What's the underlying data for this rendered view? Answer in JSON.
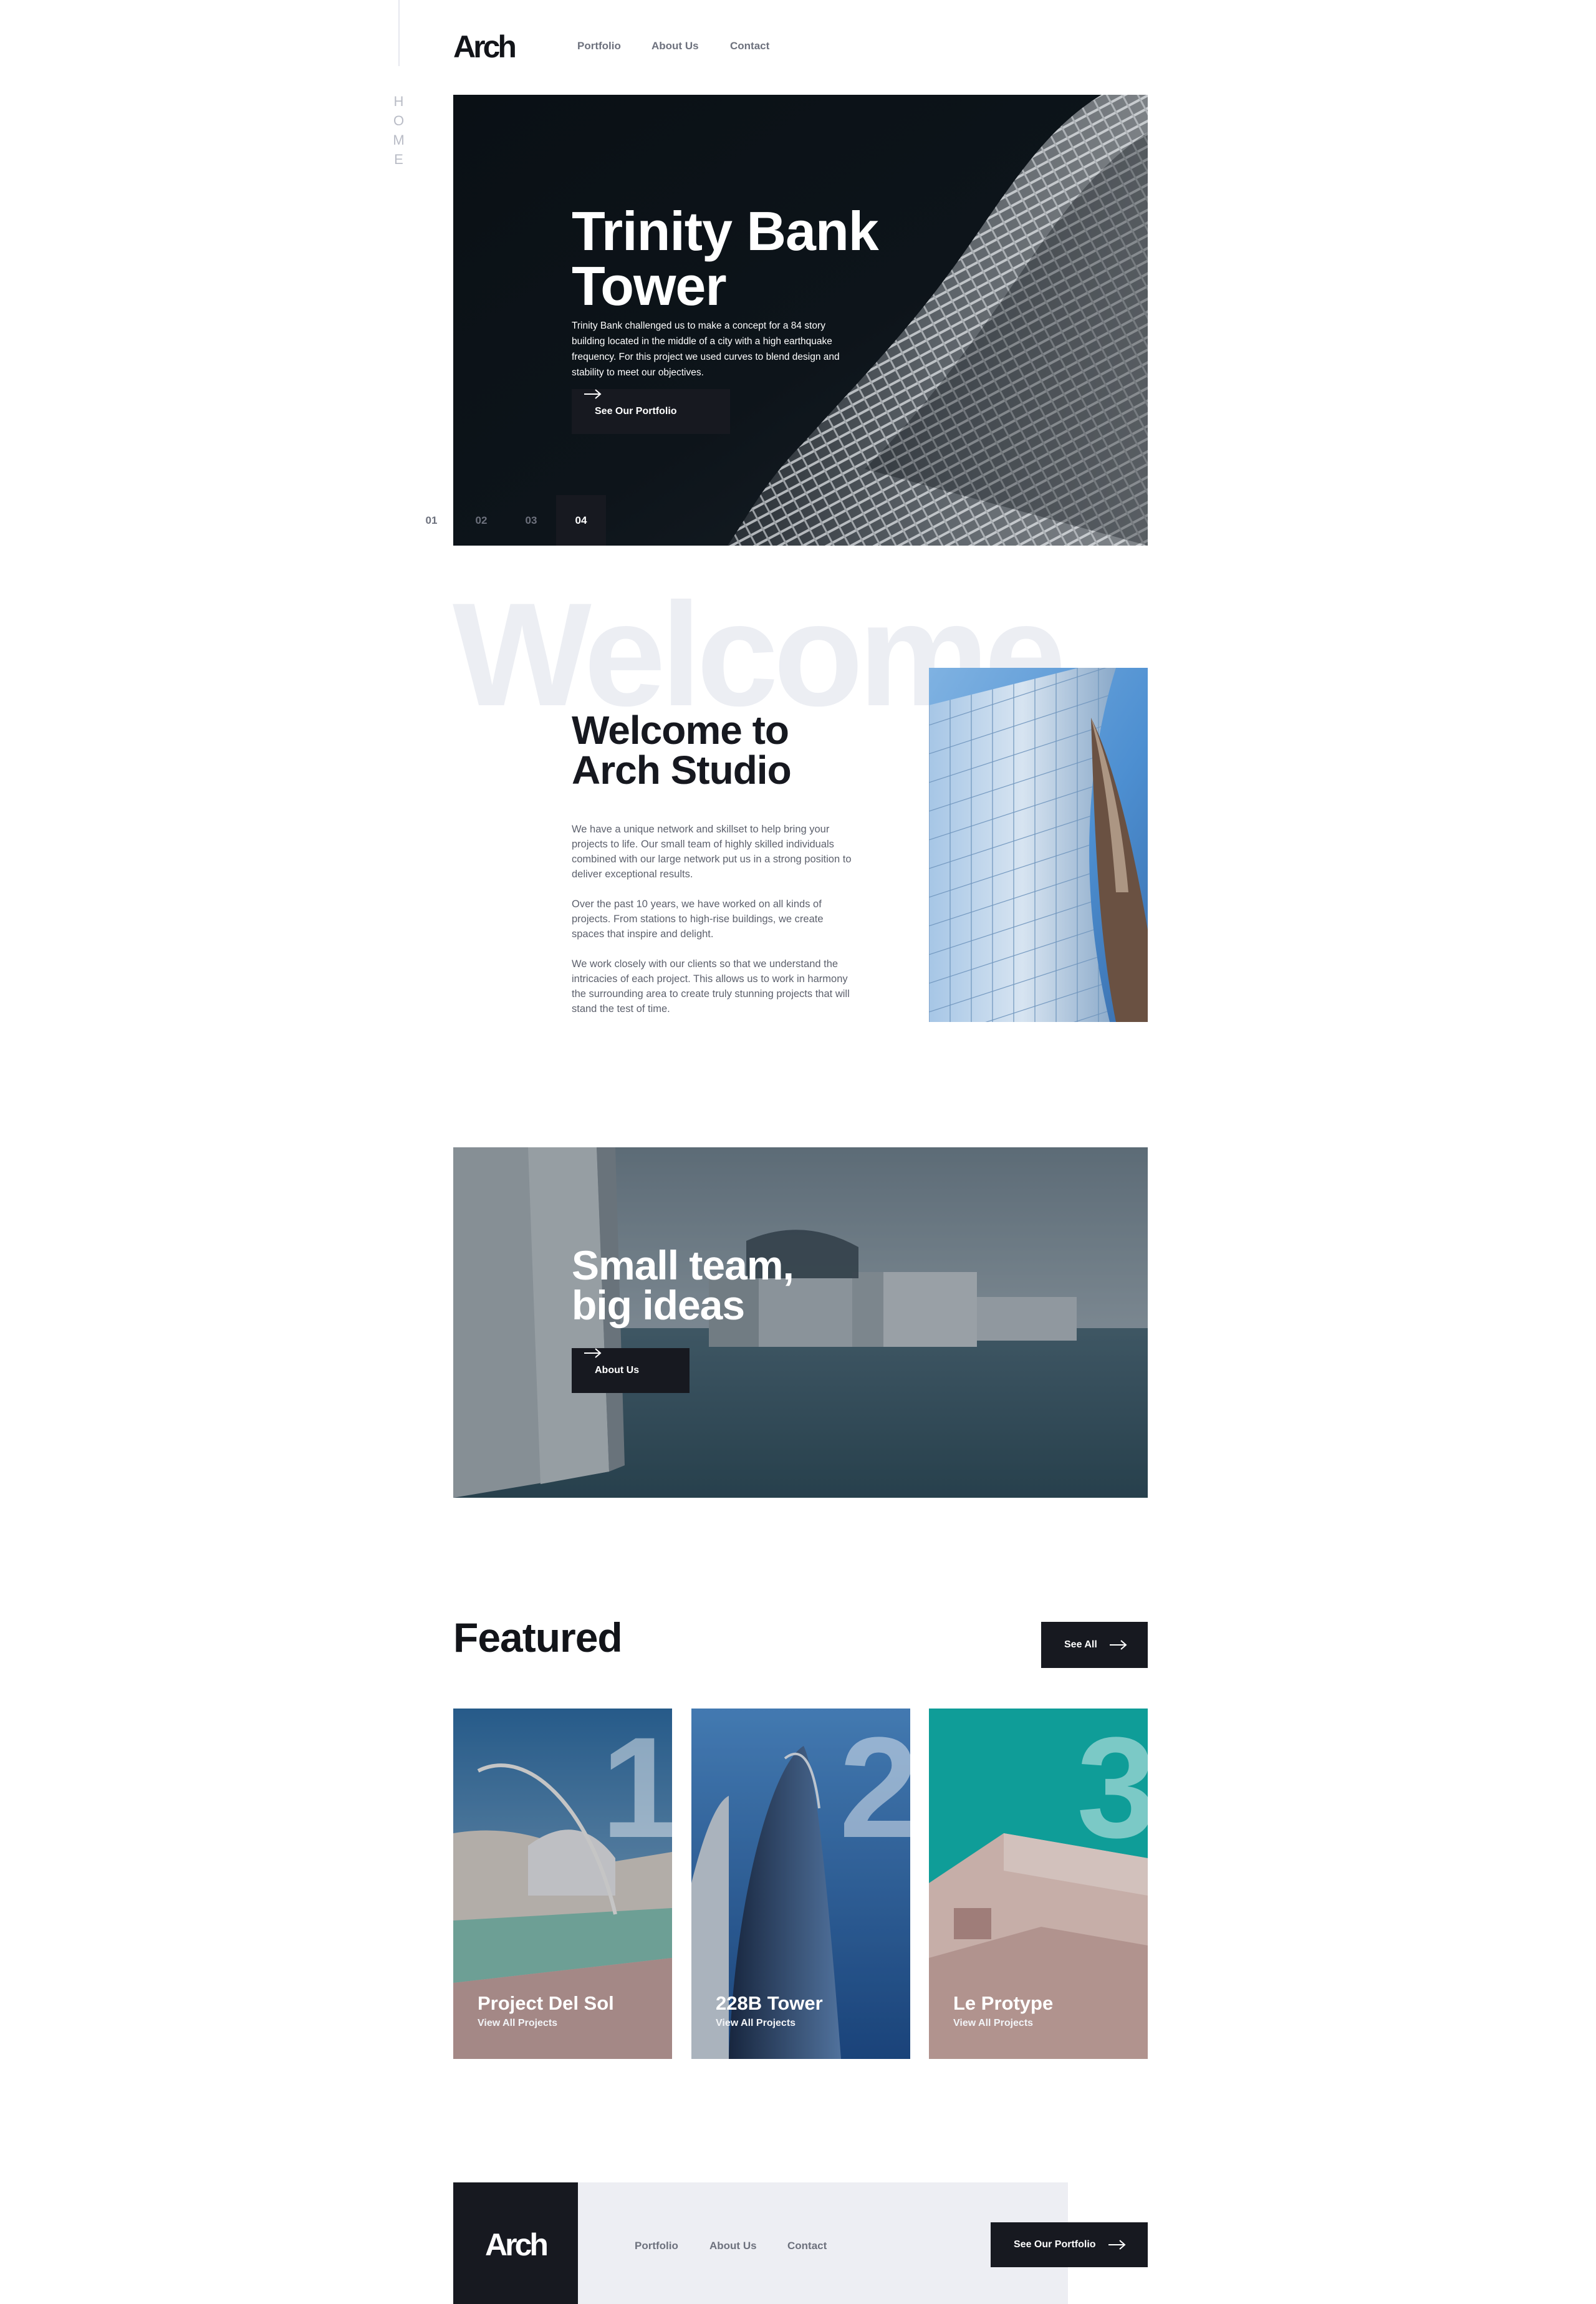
{
  "side_label": "HOME",
  "brand": {
    "logo": "Arch"
  },
  "nav": {
    "items": [
      "Portfolio",
      "About Us",
      "Contact"
    ]
  },
  "hero": {
    "title_line1": "Trinity Bank",
    "title_line2": "Tower",
    "description": "Trinity Bank challenged us to make a concept for a 84 story building located in the middle of a city with a high earthquake frequency. For this project we used curves to blend design and stability to meet our objectives.",
    "cta": "See Our Portfolio",
    "slides": [
      "01",
      "02",
      "03",
      "04"
    ],
    "active_slide": "04"
  },
  "welcome": {
    "background_word": "Welcome",
    "title_line1": "Welcome to",
    "title_line2": "Arch Studio",
    "paragraphs": [
      "We have a unique network and skillset to help bring your projects to life. Our small team of highly skilled individuals combined with our large network put us in a strong position to deliver exceptional results.",
      "Over the past 10 years, we have worked on all kinds of projects. From stations to high-rise buildings, we create spaces that inspire and delight.",
      "We work closely with our clients so that we understand the intricacies of each project. This allows us to work in harmony the surrounding area to create truly stunning projects that will stand the test of time."
    ]
  },
  "team": {
    "title_line1": "Small team,",
    "title_line2": "big ideas",
    "cta": "About Us"
  },
  "featured": {
    "title": "Featured",
    "see_all": "See All",
    "cards": [
      {
        "number": "1",
        "title": "Project Del Sol",
        "link": "View All Projects"
      },
      {
        "number": "2",
        "title": "228B Tower",
        "link": "View All Projects"
      },
      {
        "number": "3",
        "title": "Le Protype",
        "link": "View All Projects"
      }
    ]
  },
  "footer": {
    "logo": "Arch",
    "nav": [
      "Portfolio",
      "About Us",
      "Contact"
    ],
    "cta": "See Our Portfolio"
  },
  "colors": {
    "dark": "#171920",
    "text_gray": "#6d717d",
    "light_bg": "#edeef3",
    "watermark": "#eceef3"
  },
  "icons": {
    "arrow": "arrow-right-icon"
  }
}
